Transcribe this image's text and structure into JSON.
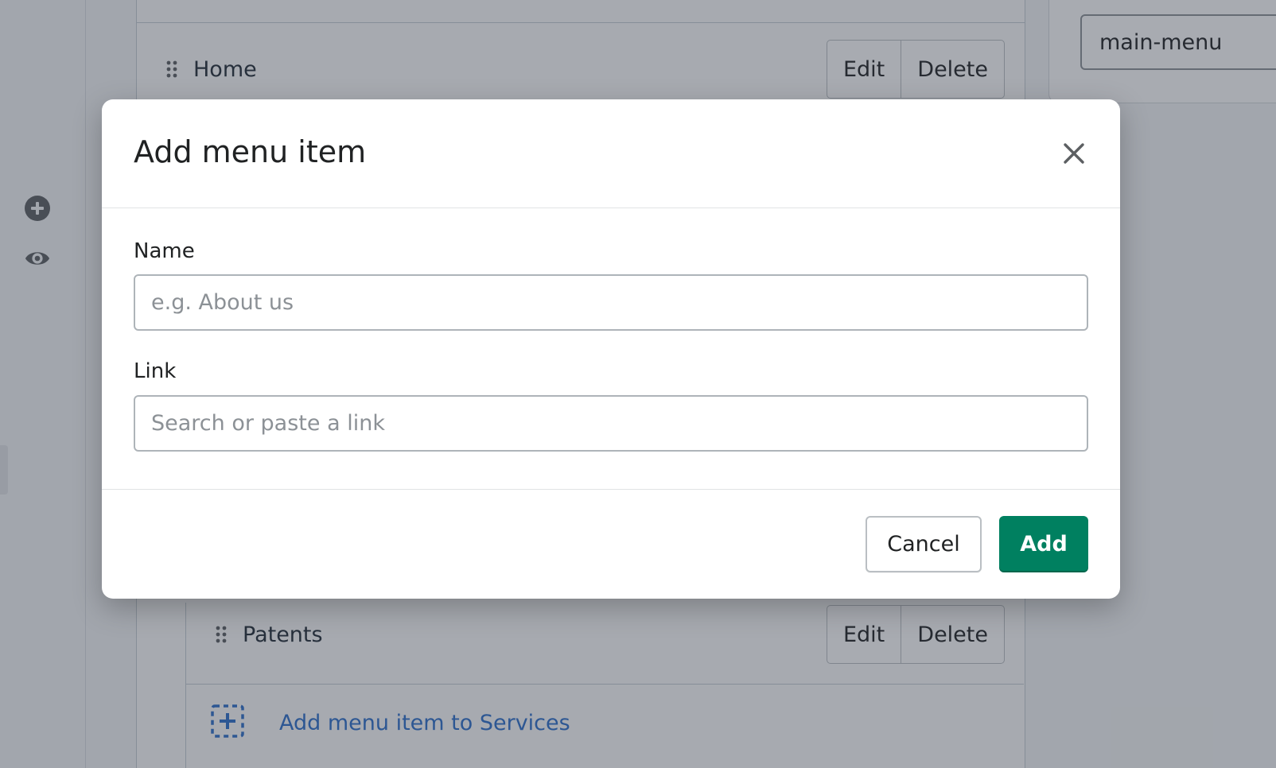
{
  "background": {
    "menu_items": [
      {
        "label": "Home",
        "edit_label": "Edit",
        "delete_label": "Delete"
      },
      {
        "label": "Patents",
        "edit_label": "Edit",
        "delete_label": "Delete"
      }
    ],
    "add_to_services_label": "Add menu item to Services",
    "handle_value": "main-menu",
    "rail_icons": [
      "add-circle-icon",
      "eye-icon"
    ]
  },
  "modal": {
    "title": "Add menu item",
    "close_icon": "close-icon",
    "name_label": "Name",
    "name_placeholder": "e.g. About us",
    "name_value": "",
    "link_label": "Link",
    "link_placeholder": "Search or paste a link",
    "link_value": "",
    "cancel_label": "Cancel",
    "add_label": "Add"
  },
  "colors": {
    "primary": "#008060",
    "link": "#2c6ecb",
    "overlay": "rgba(48,56,68,0.42)"
  }
}
